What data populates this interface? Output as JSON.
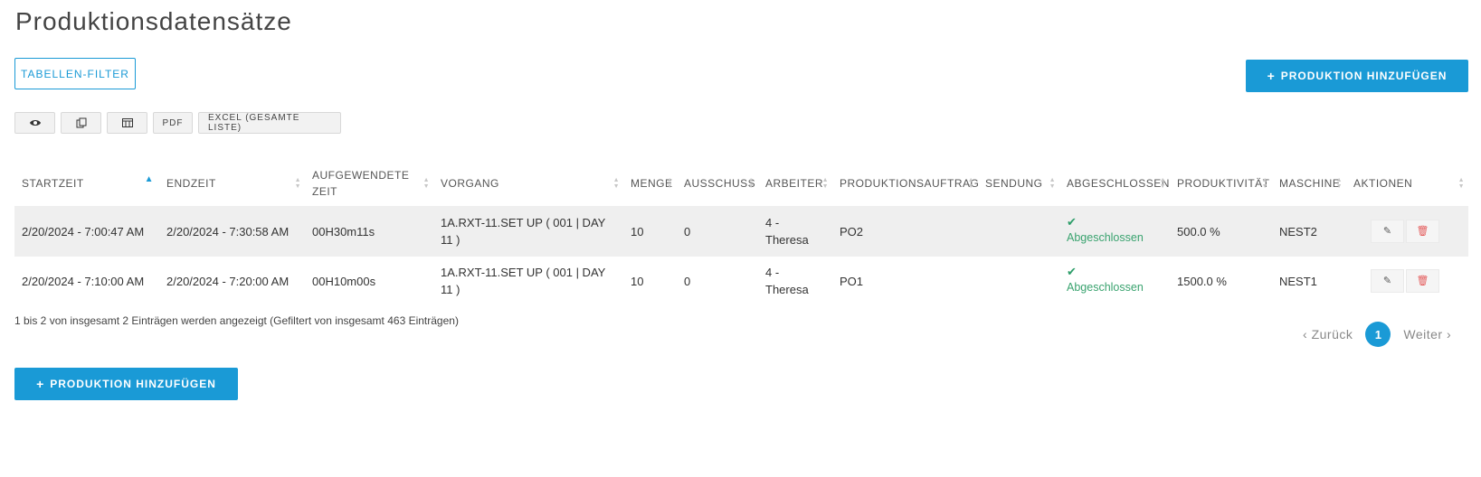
{
  "page": {
    "title": "Produktionsdatensätze"
  },
  "toolbar": {
    "filter_label": "TABELLEN-FILTER",
    "add_label": "PRODUKTION HINZUFÜGEN",
    "pdf_label": "PDF",
    "excel_label": "EXCEL (GESAMTE LISTE)",
    "icons": [
      "eye-icon",
      "copy-icon",
      "columns-icon"
    ]
  },
  "table": {
    "columns": [
      "STARTZEIT",
      "ENDZEIT",
      "AUFGEWENDETE ZEIT",
      "VORGANG",
      "MENGE",
      "AUSSCHUSS",
      "ARBEITER",
      "PRODUKTIONSAUFTRAG",
      "SENDUNG",
      "ABGESCHLOSSEN",
      "PRODUKTIVITÄT",
      "MASCHINE",
      "AKTIONEN"
    ],
    "sorted_column": "STARTZEIT",
    "rows": [
      {
        "start": "2/20/2024 - 7:00:47 AM",
        "end": "2/20/2024 - 7:30:58 AM",
        "duration": "00H30m11s",
        "operation": "1A.RXT-11.SET UP ( 001 | DAY 11 )",
        "quantity": "10",
        "scrap": "0",
        "worker": "4 - Theresa",
        "order": "PO2",
        "shipment": "",
        "completed": "Abgeschlossen",
        "productivity": "500.0 %",
        "machine": "NEST2"
      },
      {
        "start": "2/20/2024 - 7:10:00 AM",
        "end": "2/20/2024 - 7:20:00 AM",
        "duration": "00H10m00s",
        "operation": "1A.RXT-11.SET UP ( 001 | DAY 11 )",
        "quantity": "10",
        "scrap": "0",
        "worker": "4 - Theresa",
        "order": "PO1",
        "shipment": "",
        "completed": "Abgeschlossen",
        "productivity": "1500.0 %",
        "machine": "NEST1"
      }
    ]
  },
  "footer": {
    "info": "1 bis 2 von insgesamt 2 Einträgen werden angezeigt (Gefiltert von insgesamt 463 Einträgen)",
    "prev": "Zurück",
    "next": "Weiter",
    "current_page": "1"
  },
  "colors": {
    "accent": "#1a9ad6",
    "success": "#3aa36f",
    "danger": "#e45a5a"
  }
}
